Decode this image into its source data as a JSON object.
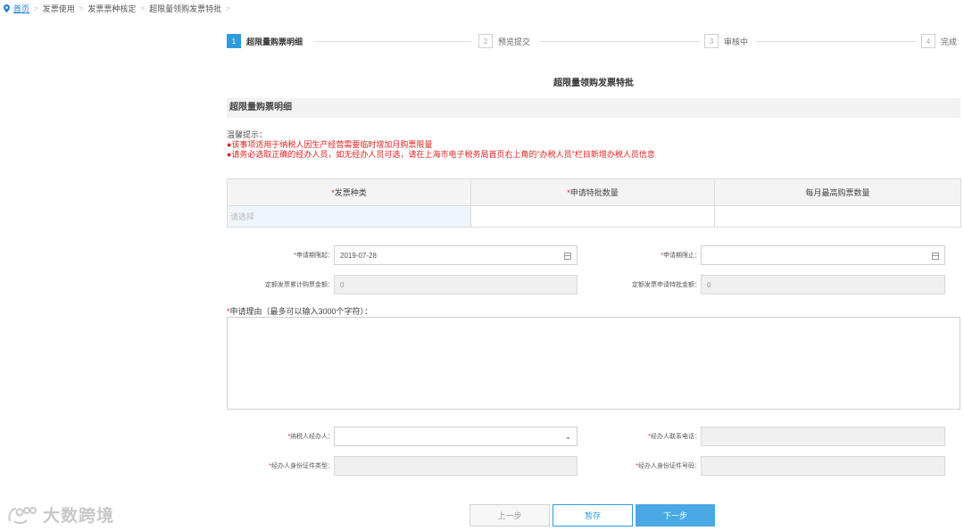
{
  "breadcrumb": {
    "home": "首页",
    "items": [
      "发票使用",
      "发票票种核定",
      "超限量领购发票特批"
    ]
  },
  "steps": [
    {
      "num": "1",
      "label": "超限量购票明细",
      "active": true
    },
    {
      "num": "2",
      "label": "预览提交",
      "active": false
    },
    {
      "num": "3",
      "label": "审核中",
      "active": false
    },
    {
      "num": "4",
      "label": "完成",
      "active": false
    }
  ],
  "form": {
    "title": "超限量领购发票特批",
    "section_title": "超限量购票明细",
    "tips": {
      "title": "温馨提示：",
      "line1": "●该事项适用于纳税人因生产经营需要临时增加月购票限量",
      "line2": "●请务必选取正确的经办人员，如无经办人员可选，请在上海市电子税务局首页右上角的\"办税人员\"栏目新增办税人员信息"
    },
    "table": {
      "headers": [
        "发票种类",
        "申请特批数量",
        "每月最高购票数量"
      ],
      "row": [
        "请选择",
        "",
        ""
      ]
    },
    "fields": {
      "apply_start_label": "申请期限起：",
      "apply_start_value": "2019-07-28",
      "apply_end_label": "申请期限止：",
      "apply_end_value": "",
      "fixed_total_label": "定额发票累计购票金额：",
      "fixed_total_value": "0",
      "fixed_approve_label": "定额发票申请特批金额：",
      "fixed_approve_value": "0",
      "reason_label": "申请理由（最多可以输入3000个字符）：",
      "agent_label": "纳税人经办人：",
      "agent_value": "",
      "agent_phone_label": "经办人联系电话：",
      "agent_phone_value": "",
      "id_type_label": "经办人身份证件类型：",
      "id_type_value": "",
      "id_number_label": "经办人身份证件号码：",
      "id_number_value": ""
    }
  },
  "buttons": {
    "prev": "上一步",
    "save": "暂存",
    "next": "下一步"
  },
  "watermark": "大数跨境",
  "colors": {
    "accent": "#2e9bdc",
    "required": "#e02020",
    "link": "#1a7fd6"
  }
}
